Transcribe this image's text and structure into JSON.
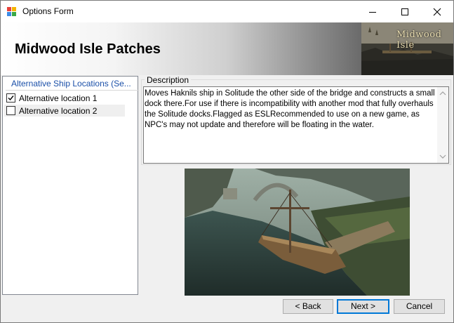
{
  "window": {
    "title": "Options Form",
    "controls": {
      "minimize_icon": "minimize-icon",
      "maximize_icon": "maximize-icon",
      "close_icon": "close-icon"
    }
  },
  "header": {
    "title": "Midwood Isle Patches",
    "logo_text": "Midwood Isle"
  },
  "options": {
    "group_title": "Alternative Ship Locations (Se...",
    "items": [
      {
        "label": "Alternative location 1",
        "checked": true
      },
      {
        "label": "Alternative location 2",
        "checked": false
      }
    ]
  },
  "description": {
    "label": "Description",
    "text": "Moves Haknils ship in Solitude the other side of the bridge and constructs a small dock there.For use if there is incompatibility with another mod that fully overhauls the Solitude docks.Flagged as ESLRecommended to use on a new game, as NPC's may not update and therefore will be floating in the water."
  },
  "buttons": {
    "back": "< Back",
    "next": "Next >",
    "cancel": "Cancel"
  },
  "colors": {
    "accent": "#0078d7",
    "group_title": "#1a4fa8",
    "window_bg": "#f0f0f0"
  }
}
